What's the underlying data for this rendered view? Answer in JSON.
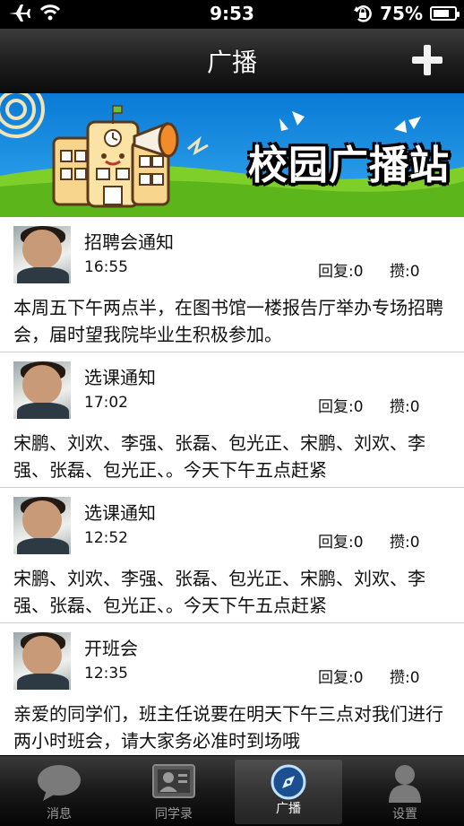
{
  "status_bar": {
    "time": "9:53",
    "battery": "75%",
    "battery_level": 0.75
  },
  "nav": {
    "title": "广播"
  },
  "banner": {
    "title": "校园广播站"
  },
  "posts": [
    {
      "title": "招聘会通知",
      "time": "16:55",
      "reply": "回复:0",
      "like": "攒:0",
      "body": "本周五下午两点半，在图书馆一楼报告厅举办专场招聘会，届时望我院毕业生积极参加。"
    },
    {
      "title": "选课通知",
      "time": "17:02",
      "reply": "回复:0",
      "like": "攒:0",
      "body": "宋鹏、刘欢、李强、张磊、包光正、宋鹏、刘欢、李强、张磊、包光正、。今天下午五点赶紧"
    },
    {
      "title": "选课通知",
      "time": "12:52",
      "reply": "回复:0",
      "like": "攒:0",
      "body": "宋鹏、刘欢、李强、张磊、包光正、宋鹏、刘欢、李强、张磊、包光正、。今天下午五点赶紧"
    },
    {
      "title": "开班会",
      "time": "12:35",
      "reply": "回复:0",
      "like": "攒:0",
      "body": "亲爱的同学们，班主任说要在明天下午三点对我们进行两小时班会，请大家务必准时到场哦"
    }
  ],
  "tabs": [
    {
      "label": "消息",
      "icon": "chat-bubble-icon",
      "active": false
    },
    {
      "label": "同学录",
      "icon": "contact-card-icon",
      "active": false
    },
    {
      "label": "广播",
      "icon": "compass-icon",
      "active": true
    },
    {
      "label": "设置",
      "icon": "person-icon",
      "active": false
    }
  ]
}
